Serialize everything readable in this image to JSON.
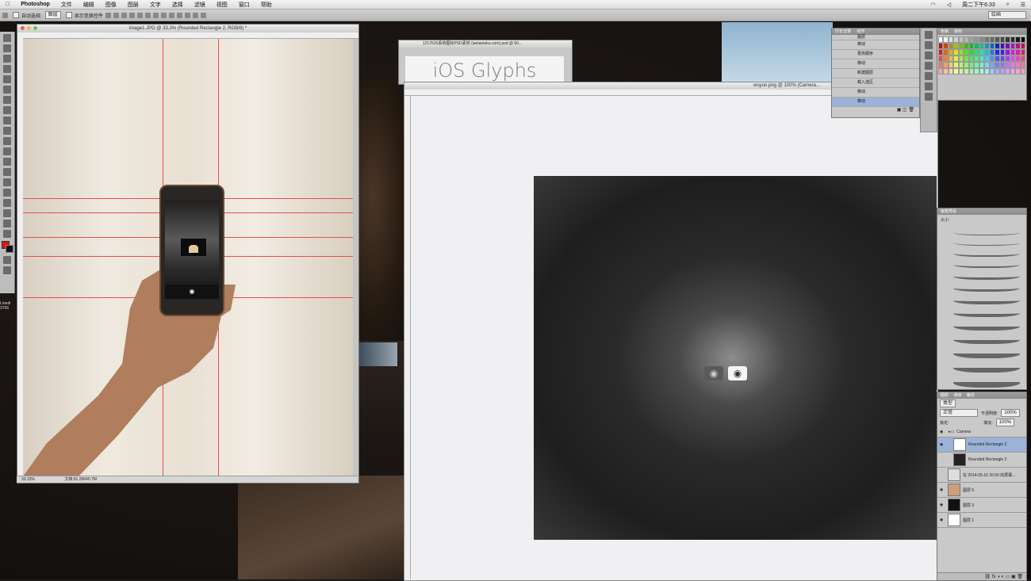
{
  "menubar": {
    "app": "Photoshop",
    "items": [
      "文件",
      "编辑",
      "图像",
      "图层",
      "文字",
      "选择",
      "滤镜",
      "视图",
      "窗口",
      "帮助"
    ],
    "clock": "周二下午6:33",
    "search_placeholder": "绘画"
  },
  "optbar": {
    "auto_select_label": "自动选择:",
    "auto_select_value": "图层",
    "show_transform_label": "显示变换控件"
  },
  "doc1": {
    "title": "image1.JPG @ 33.3% (Rounded Rectangle 2, RGB/8) *",
    "zoom": "33.33%",
    "doc_size": "文档:91.2M/40.7M"
  },
  "doc2": {
    "title": "1217iOS系统图标PSD素材 (ianiaotuku.com).psd @ 60...",
    "banner_text": "iOS Glyphs"
  },
  "doc3": {
    "title": "wuyun.png @ 100% (Camera..."
  },
  "history": {
    "tabs": [
      "历史记录",
      "动作"
    ],
    "items": [
      "移动",
      "更改顺序",
      "移动",
      "新建图层",
      "载入选区",
      "移动",
      "移动"
    ],
    "first_item": "图层",
    "active_index": 6
  },
  "swatches": {
    "tabs": [
      "色板",
      "颜色"
    ]
  },
  "brushes": {
    "title": "画笔预设",
    "size_label": "大小:"
  },
  "layers": {
    "tabs": [
      "图层",
      "通道",
      "路径"
    ],
    "filter": "类型",
    "blend": "正常",
    "opacity_label": "不透明度:",
    "opacity": "100%",
    "lock_label": "锁定:",
    "fill_label": "填充:",
    "fill": "100%",
    "items": [
      {
        "name": "Camera",
        "kind": "group"
      },
      {
        "name": "Rounded Rectangle 2",
        "kind": "shape",
        "active": true
      },
      {
        "name": "Rounded Rectangle 2",
        "kind": "shape"
      },
      {
        "name": "在 2014-05-16 20.56 的屏幕...",
        "kind": "image"
      },
      {
        "name": "图层 5",
        "kind": "image"
      },
      {
        "name": "图层 3",
        "kind": "image"
      },
      {
        "name": "图层 1",
        "kind": "image"
      }
    ]
  },
  "left_labels": [
    "Linedi",
    "3766"
  ],
  "colors": {
    "guide": "#e05050",
    "active_row": "#9cb2d6"
  }
}
